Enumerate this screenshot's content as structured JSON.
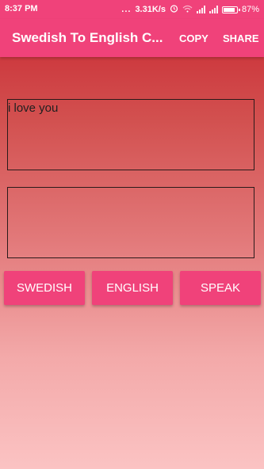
{
  "status_bar": {
    "time": "8:37 PM",
    "dots": "...",
    "network_speed": "3.31K/s",
    "battery_percent": "87%",
    "battery_level": 0.87
  },
  "app_bar": {
    "title": "Swedish To English C...",
    "copy_label": "COPY",
    "share_label": "SHARE",
    "color": "#f0427a"
  },
  "input": {
    "value": "i love you"
  },
  "output": {
    "value": ""
  },
  "buttons": {
    "swedish_label": "SWEDISH",
    "english_label": "ENGLISH",
    "speak_label": "SPEAK"
  }
}
